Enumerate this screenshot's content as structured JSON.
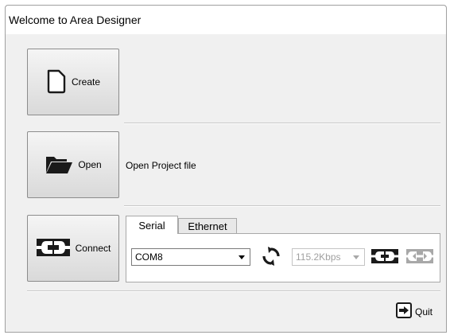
{
  "window": {
    "title": "Welcome to Area Designer"
  },
  "buttons": {
    "create": "Create",
    "open": "Open",
    "connect": "Connect",
    "quit": "Quit"
  },
  "open_description": "Open Project file",
  "connection_tabs": [
    {
      "label": "Serial",
      "active": true
    },
    {
      "label": "Ethernet",
      "active": false
    }
  ],
  "serial": {
    "port_value": "COM8",
    "baud_value": "115.2Kbps",
    "baud_enabled": false
  },
  "icons": {
    "create": "new-document-icon",
    "open": "open-folder-icon",
    "connect": "connect-plug-icon",
    "refresh": "refresh-icon",
    "connect_small": "connect-icon",
    "disconnect_small": "disconnect-icon",
    "quit": "exit-icon"
  },
  "colors": {
    "icon_dark": "#1a1a1a",
    "disabled_icon": "#a8a8a8",
    "tab_active_bg": "#ffffff",
    "window_bg": "#f0f0f0"
  }
}
